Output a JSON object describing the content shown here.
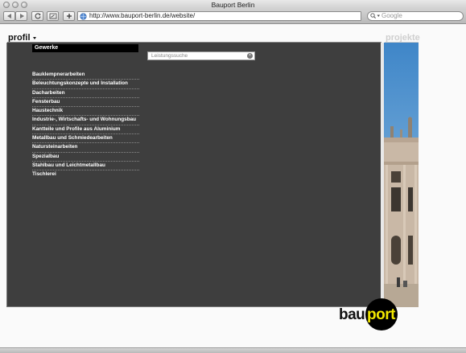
{
  "window": {
    "title": "Bauport Berlin"
  },
  "toolbar": {
    "url": "http://www.bauport-berlin.de/website/",
    "search_placeholder": "Google"
  },
  "nav": {
    "profil": "profil",
    "projekte": "projekte"
  },
  "panel": {
    "tab_label": "Gewerke",
    "search_placeholder": "Leistungssuche",
    "items": [
      {
        "label": "Bauklempnerarbeiten"
      },
      {
        "label": "Beleuchtungskonzepte und Installation"
      },
      {
        "label": "Dacharbeiten"
      },
      {
        "label": "Fensterbau"
      },
      {
        "label": "Haustechnik"
      },
      {
        "label": "Industrie-, Wirtschafts- und Wohnungsbau"
      },
      {
        "label": "Kantteile und Profile aus Aluminium"
      },
      {
        "label": "Metallbau und Schmiedearbeiten"
      },
      {
        "label": "Natursteinarbeiten"
      },
      {
        "label": "Spezialbau"
      },
      {
        "label": "Stahlbau und Leichtmetallbau"
      },
      {
        "label": "Tischlerei"
      }
    ]
  },
  "logo": {
    "part1": "bau",
    "part2": "port",
    "accent_color": "#f2e800"
  },
  "colors": {
    "panel_bg": "#3e3e3e",
    "tab_bg": "#000000"
  }
}
